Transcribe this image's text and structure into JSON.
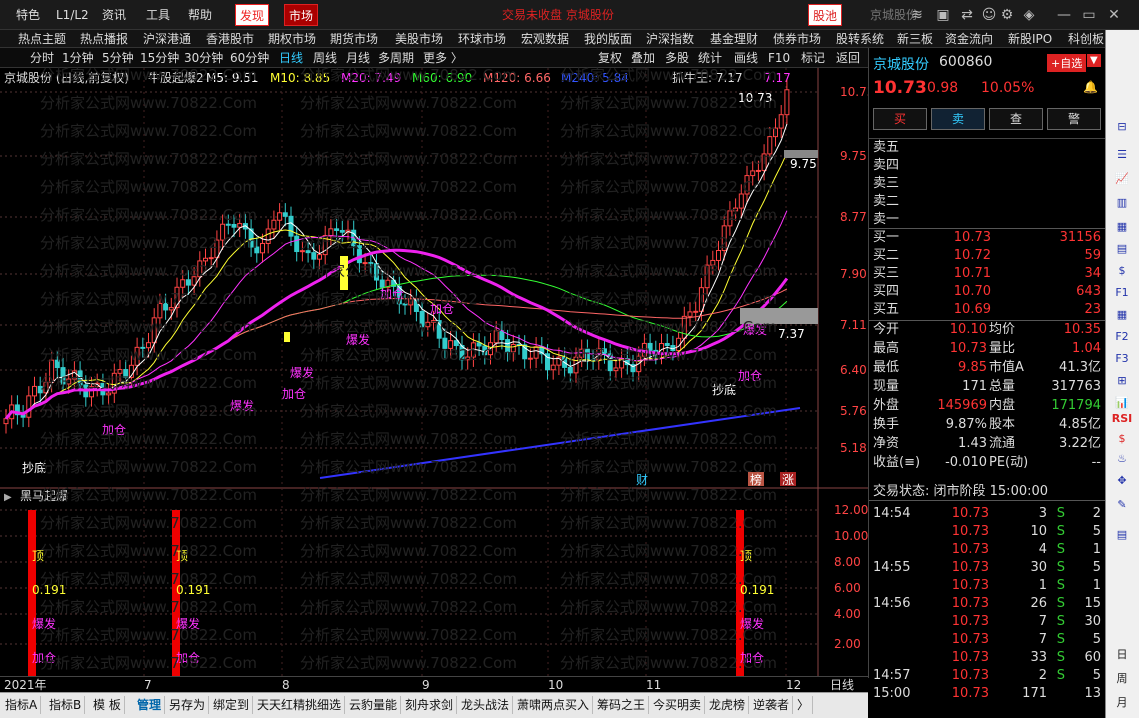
{
  "menu": {
    "items": [
      "特色",
      "L1/L2",
      "资讯",
      "工具",
      "帮助"
    ],
    "discover": "发现",
    "market": "市场",
    "ticker_banner": "交易未收盘 京城股份",
    "stock_pool": "股池",
    "top_right": "京城股份"
  },
  "nav": [
    "热点主题",
    "热点播报",
    "沪深港通",
    "香港股市",
    "期权市场",
    "期货市场",
    "美股市场",
    "环球市场",
    "宏观数据",
    "我的版面",
    "沪深指数",
    "基金理财",
    "债券市场",
    "股转系统",
    "新三板",
    "资金流向",
    "新股IPO",
    "科创板"
  ],
  "period": {
    "items": [
      "分时",
      "1分钟",
      "5分钟",
      "15分钟",
      "30分钟",
      "60分钟",
      "日线",
      "周线",
      "月线",
      "多周期",
      "更多 〉"
    ],
    "active": "日线",
    "tools": [
      "复权",
      "叠加",
      "多股",
      "统计",
      "画线",
      "F10",
      "标记",
      "返回"
    ]
  },
  "chart": {
    "title": "京城股份 (日线,前复权)",
    "indicator": "牛股起爆2",
    "ma": [
      {
        "label": "M5: 9.51",
        "color": "#ffffff"
      },
      {
        "label": "M10: 8.85",
        "color": "#ffff33"
      },
      {
        "label": "M20: 7.49",
        "color": "#ff33ff"
      },
      {
        "label": "M60: 6.90",
        "color": "#33ff33"
      },
      {
        "label": "M120: 6.66",
        "color": "#ff6666"
      },
      {
        "label": "M240: 5.84",
        "color": "#3355ff"
      }
    ],
    "extra": "抓牛王: 7.17",
    "extra2": "7.17",
    "price_axis": [
      "10.73",
      "9.75",
      "8.77",
      "7.90",
      "7.11",
      "6.40",
      "5.76",
      "5.18"
    ],
    "sub_axis": [
      "12.00",
      "10.00",
      "8.00",
      "6.00",
      "4.00",
      "2.00"
    ],
    "sub_title": "黑马起爆",
    "high_label": "10.73",
    "mid_label": "9.75",
    "low_marker": "7.37",
    "annotations": {
      "chaodi": "抄底",
      "baofa": "爆发",
      "jiacang": "加仓",
      "cai": "财",
      "bang": "榜",
      "zhang": "涨"
    },
    "sub_signals": {
      "top": "顶",
      "value": "0.191",
      "baofa": "爆发",
      "jiacang": "加仓"
    },
    "months": [
      "2021年",
      "7",
      "8",
      "9",
      "10",
      "11",
      "12"
    ],
    "period_label": "日线"
  },
  "quote": {
    "name": "京城股份",
    "code": "600860",
    "price": "10.73",
    "change": "0.98",
    "pct": "10.05%",
    "add_btn": "+自选",
    "buttons": [
      "买",
      "卖",
      "查",
      "警"
    ],
    "sells": [
      "卖五",
      "卖四",
      "卖三",
      "卖二",
      "卖一"
    ],
    "buys": [
      {
        "label": "买一",
        "price": "10.73",
        "vol": "31156"
      },
      {
        "label": "买二",
        "price": "10.72",
        "vol": "59"
      },
      {
        "label": "买三",
        "price": "10.71",
        "vol": "34"
      },
      {
        "label": "买四",
        "price": "10.70",
        "vol": "643"
      },
      {
        "label": "买五",
        "price": "10.69",
        "vol": "23"
      }
    ],
    "stats": [
      {
        "l1": "今开",
        "v1": "10.10",
        "c1": "red",
        "l2": "均价",
        "v2": "10.35",
        "c2": "red"
      },
      {
        "l1": "最高",
        "v1": "10.73",
        "c1": "red",
        "l2": "量比",
        "v2": "1.04",
        "c2": "red"
      },
      {
        "l1": "最低",
        "v1": "9.85",
        "c1": "red",
        "l2": "市值A",
        "v2": "41.3亿",
        "c2": "wht"
      },
      {
        "l1": "现量",
        "v1": "171",
        "c1": "wht",
        "l2": "总量",
        "v2": "317763",
        "c2": "wht"
      },
      {
        "l1": "外盘",
        "v1": "145969",
        "c1": "red",
        "l2": "内盘",
        "v2": "171794",
        "c2": "grn"
      },
      {
        "l1": "换手",
        "v1": "9.87%",
        "c1": "wht",
        "l2": "股本",
        "v2": "4.85亿",
        "c2": "wht"
      },
      {
        "l1": "净资",
        "v1": "1.43",
        "c1": "wht",
        "l2": "流通",
        "v2": "3.22亿",
        "c2": "wht"
      },
      {
        "l1": "收益(≡)",
        "v1": "-0.010",
        "c1": "wht",
        "l2": "PE(动)",
        "v2": "--",
        "c2": "wht"
      }
    ],
    "trade_state": "交易状态: 闭市阶段 15:00:00",
    "ticks": [
      {
        "t": "14:54",
        "p": "10.73",
        "v": "3",
        "s": "S",
        "n": "2"
      },
      {
        "t": "",
        "p": "10.73",
        "v": "10",
        "s": "S",
        "n": "5"
      },
      {
        "t": "",
        "p": "10.73",
        "v": "4",
        "s": "S",
        "n": "1"
      },
      {
        "t": "14:55",
        "p": "10.73",
        "v": "30",
        "s": "S",
        "n": "5"
      },
      {
        "t": "",
        "p": "10.73",
        "v": "1",
        "s": "S",
        "n": "1"
      },
      {
        "t": "14:56",
        "p": "10.73",
        "v": "26",
        "s": "S",
        "n": "15"
      },
      {
        "t": "",
        "p": "10.73",
        "v": "7",
        "s": "S",
        "n": "30"
      },
      {
        "t": "",
        "p": "10.73",
        "v": "7",
        "s": "S",
        "n": "5"
      },
      {
        "t": "",
        "p": "10.73",
        "v": "33",
        "s": "S",
        "n": "60"
      },
      {
        "t": "14:57",
        "p": "10.73",
        "v": "2",
        "s": "S",
        "n": "5"
      },
      {
        "t": "15:00",
        "p": "10.73",
        "v": "171",
        "s": "",
        "n": "13"
      }
    ]
  },
  "sidebar": {
    "items": [
      "RSI",
      "日",
      "周",
      "月"
    ]
  },
  "bottom": [
    "指标A",
    "指标B",
    "模 板",
    "管理",
    "另存为",
    "绑定到",
    "天天红精挑细选",
    "云豹量能",
    "刻舟求剑",
    "龙头战法",
    "萧啸两点买入",
    "筹码之王",
    "今买明卖",
    "龙虎榜",
    "逆袭者",
    "〉"
  ],
  "bottom_active": "管理",
  "watermark": "分析家公式网www.70822.Com"
}
